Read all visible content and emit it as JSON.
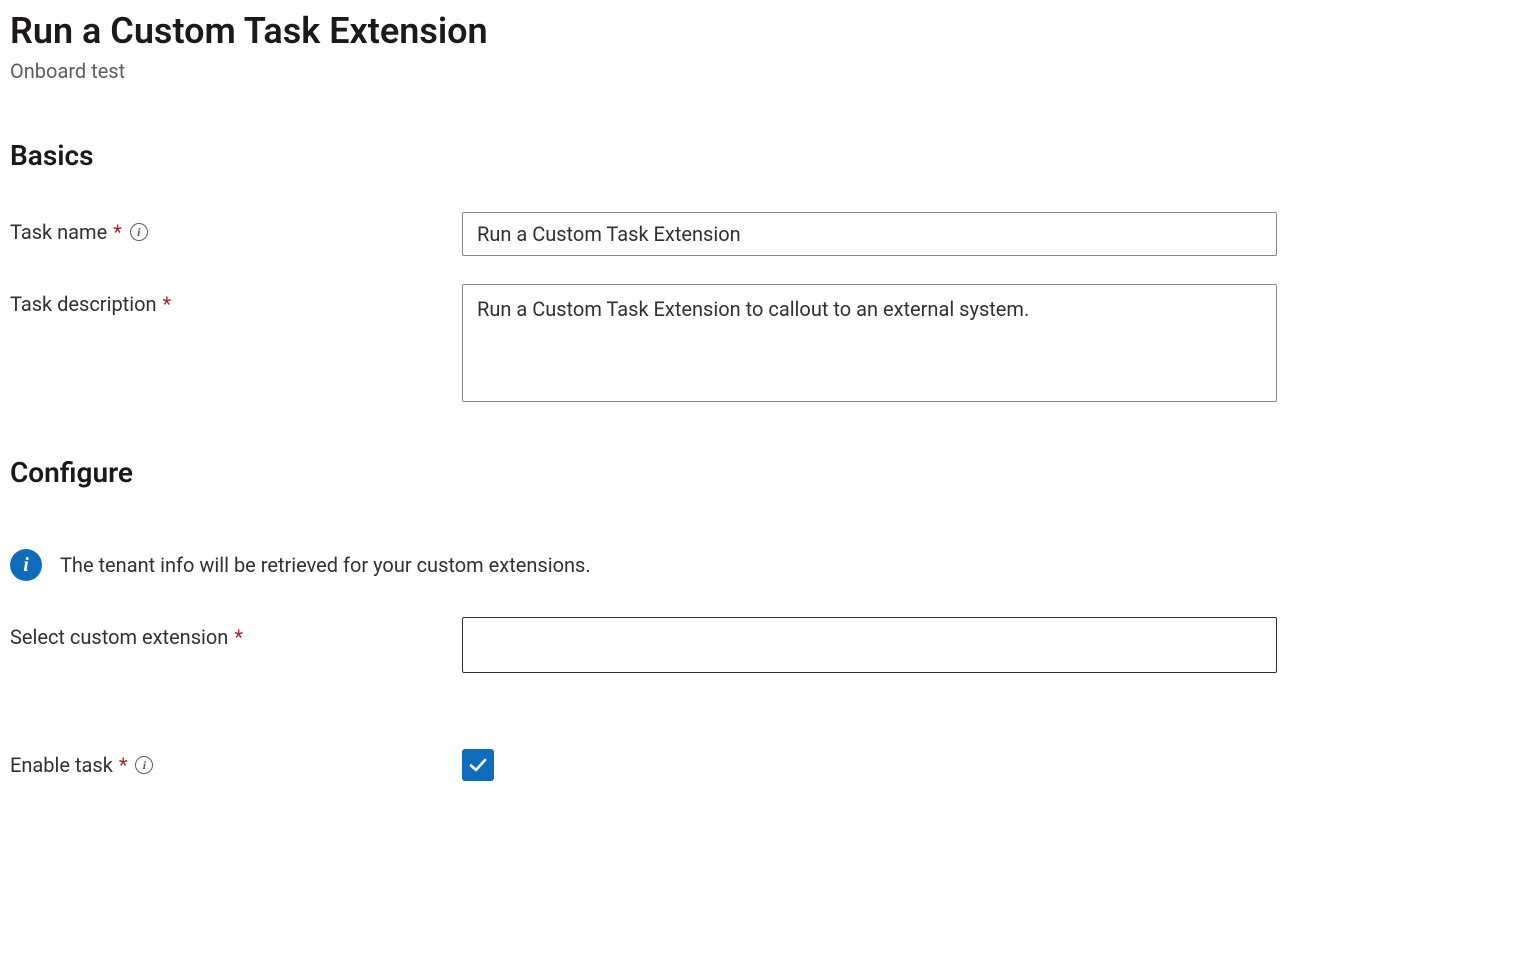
{
  "header": {
    "title": "Run a Custom Task Extension",
    "subtitle": "Onboard test"
  },
  "sections": {
    "basics": {
      "heading": "Basics"
    },
    "configure": {
      "heading": "Configure"
    }
  },
  "fields": {
    "task_name": {
      "label": "Task name",
      "value": "Run a Custom Task Extension"
    },
    "task_description": {
      "label": "Task description",
      "value": "Run a Custom Task Extension to callout to an external system."
    },
    "select_extension": {
      "label": "Select custom extension",
      "value": ""
    },
    "enable_task": {
      "label": "Enable task",
      "checked": true
    }
  },
  "info_banner": {
    "text": "The tenant info will be retrieved for your custom extensions."
  }
}
